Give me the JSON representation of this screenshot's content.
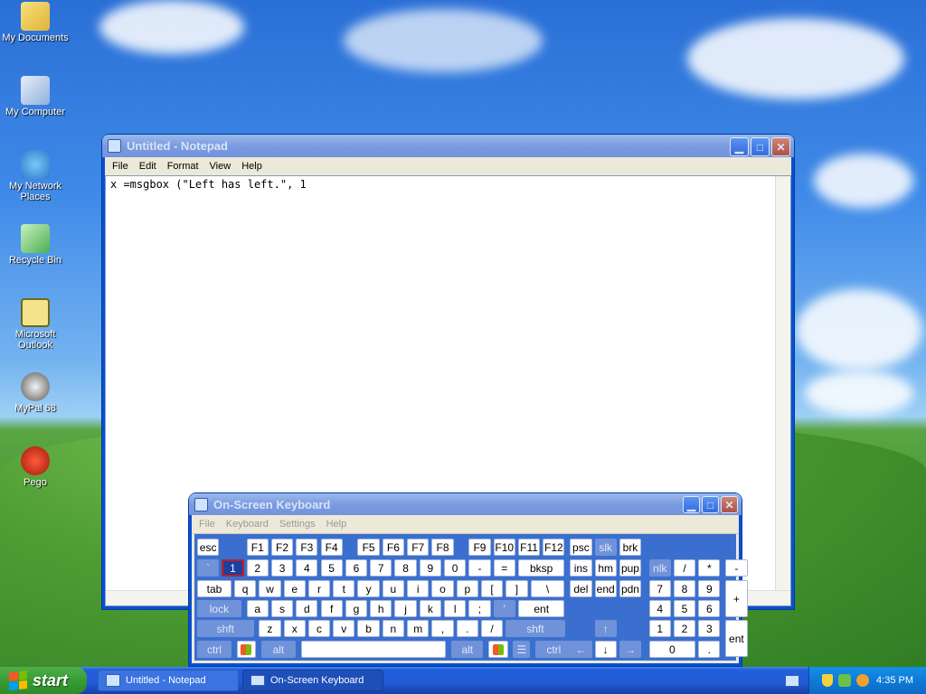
{
  "desktop": {
    "icons": [
      {
        "label": "My Documents"
      },
      {
        "label": "My Computer"
      },
      {
        "label": "My Network Places"
      },
      {
        "label": "Recycle Bin"
      },
      {
        "label": "Microsoft Outlook"
      },
      {
        "label": "MyPal 68"
      },
      {
        "label": "Pego"
      }
    ]
  },
  "notepad": {
    "title": "Untitled - Notepad",
    "menu": [
      "File",
      "Edit",
      "Format",
      "View",
      "Help"
    ],
    "content": "x =msgbox (\"Left has left.\", 1"
  },
  "osk": {
    "title": "On-Screen Keyboard",
    "menu": [
      "File",
      "Keyboard",
      "Settings",
      "Help"
    ],
    "pressed_key": "1",
    "row0": [
      "esc",
      "F1",
      "F2",
      "F3",
      "F4",
      "F5",
      "F6",
      "F7",
      "F8",
      "F9",
      "F10",
      "F11",
      "F12",
      "psc",
      "slk",
      "brk"
    ],
    "row1": [
      "`",
      "1",
      "2",
      "3",
      "4",
      "5",
      "6",
      "7",
      "8",
      "9",
      "0",
      "-",
      "=",
      "bksp",
      "ins",
      "hm",
      "pup",
      "nlk",
      "/",
      "*",
      "-"
    ],
    "row2": [
      "tab",
      "q",
      "w",
      "e",
      "r",
      "t",
      "y",
      "u",
      "i",
      "o",
      "p",
      "[",
      "]",
      "\\",
      "del",
      "end",
      "pdn",
      "7",
      "8",
      "9",
      "+"
    ],
    "row3": [
      "lock",
      "a",
      "s",
      "d",
      "f",
      "g",
      "h",
      "j",
      "k",
      "l",
      ";",
      "'",
      "ent",
      "4",
      "5",
      "6"
    ],
    "row4": [
      "shft",
      "z",
      "x",
      "c",
      "v",
      "b",
      "n",
      "m",
      ",",
      ".",
      "/",
      "shft",
      "↑",
      "1",
      "2",
      "3",
      "ent"
    ],
    "row5": [
      "ctrl",
      "alt",
      "alt",
      "ctrl",
      "←",
      "↓",
      "→",
      "0",
      "."
    ]
  },
  "taskbar": {
    "start_label": "start",
    "items": [
      "Untitled - Notepad",
      "On-Screen Keyboard"
    ],
    "clock": "4:35 PM"
  },
  "colors": {
    "titlebar": "#0b4fd8",
    "osk_bg": "#3a6fd0",
    "taskbar": "#225ad6",
    "start": "#379d32"
  }
}
